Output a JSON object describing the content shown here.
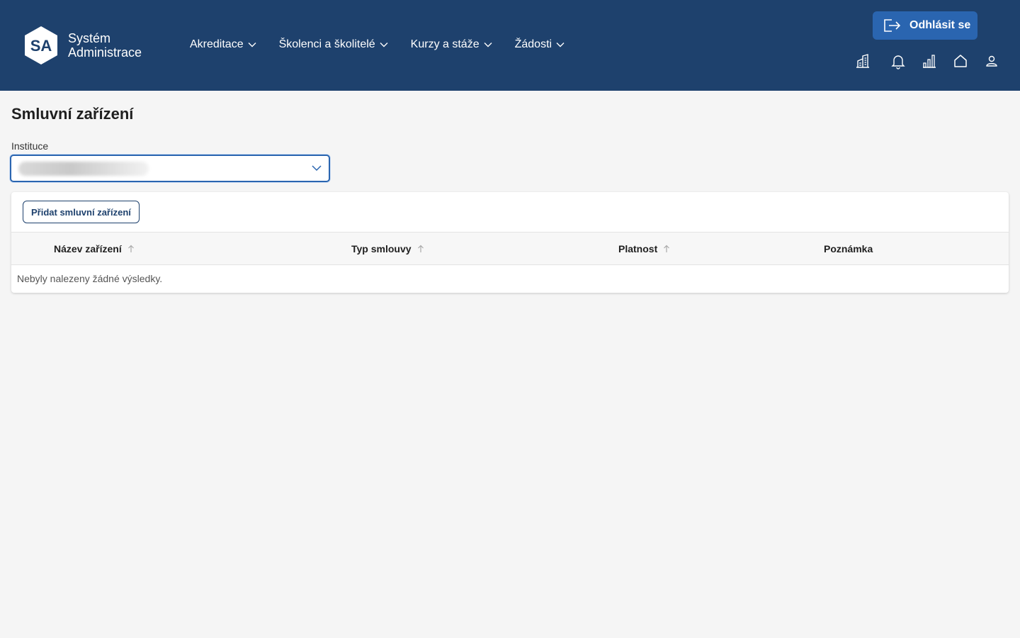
{
  "app": {
    "logo_text": "SA",
    "brand_line1": "Systém",
    "brand_line2": "Administrace"
  },
  "nav": {
    "items": [
      {
        "label": "Akreditace"
      },
      {
        "label": "Školenci a školitelé"
      },
      {
        "label": "Kurzy a stáže"
      },
      {
        "label": "Žádosti"
      }
    ]
  },
  "header": {
    "logout_label": "Odhlásit se",
    "icons": [
      "building-icon",
      "bell-icon",
      "bar-chart-icon",
      "home-icon",
      "user-icon"
    ]
  },
  "page": {
    "title": "Smluvní zařízení",
    "institution_label": "Instituce",
    "institution_value": ""
  },
  "table": {
    "add_button": "Přidat smluvní zařízení",
    "columns": [
      "Název zařízení",
      "Typ smlouvy",
      "Platnost",
      "Poznámka"
    ],
    "empty_message": "Nebyly nalezeny žádné výsledky."
  },
  "colors": {
    "header_bg": "#1e416d",
    "accent": "#2a65b0",
    "page_bg": "#f5f5f5"
  }
}
